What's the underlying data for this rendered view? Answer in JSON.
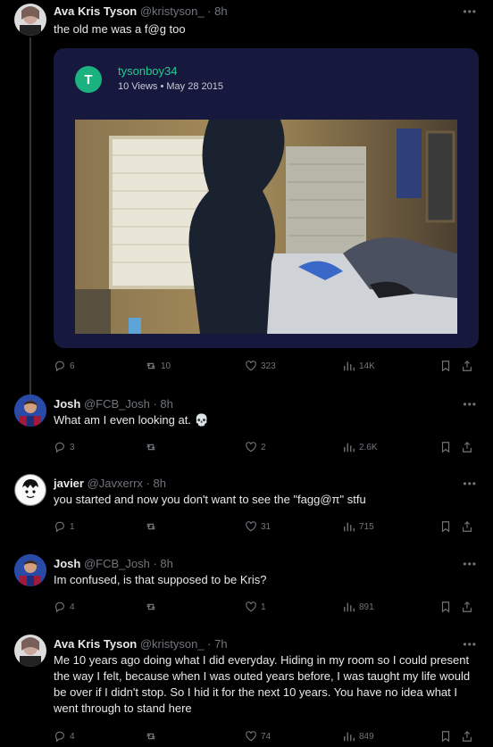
{
  "tweets": [
    {
      "name": "Ava Kris Tyson",
      "handle": "@kristyson_",
      "time": "· 8h",
      "text": "the old me was a f@g too",
      "embed": {
        "avatar_letter": "T",
        "username": "tysonboy34",
        "meta": "10 Views • May 28 2015"
      },
      "replies": "6",
      "retweets": "10",
      "likes": "323",
      "views": "14K"
    },
    {
      "name": "Josh",
      "handle": "@FCB_Josh",
      "time": "· 8h",
      "text": "What am I even looking at. 💀",
      "replies": "3",
      "retweets": "",
      "likes": "2",
      "views": "2.6K"
    },
    {
      "name": "javier",
      "handle": "@Javxerrx",
      "time": "· 8h",
      "text": "you started and now you don't want to see the \"fagg@π\" stfu",
      "replies": "1",
      "retweets": "",
      "likes": "31",
      "views": "715"
    },
    {
      "name": "Josh",
      "handle": "@FCB_Josh",
      "time": "· 8h",
      "text": "Im confused, is that supposed to be Kris?",
      "replies": "4",
      "retweets": "",
      "likes": "1",
      "views": "891"
    },
    {
      "name": "Ava Kris Tyson",
      "handle": "@kristyson_",
      "time": "· 7h",
      "text": "Me 10 years ago doing what I did everyday. Hiding in my room so I could present the way I felt, because when I was outed years before, I was taught my life would be over if I didn't stop. So I hid it for the next 10 years. You have no idea what I went through to stand here",
      "replies": "4",
      "retweets": "",
      "likes": "74",
      "views": "849"
    }
  ],
  "more_label": "•••",
  "colors": {
    "background": "#000000",
    "muted": "#71767b",
    "card": "#17183e",
    "accent_green": "#1fcf8f"
  }
}
